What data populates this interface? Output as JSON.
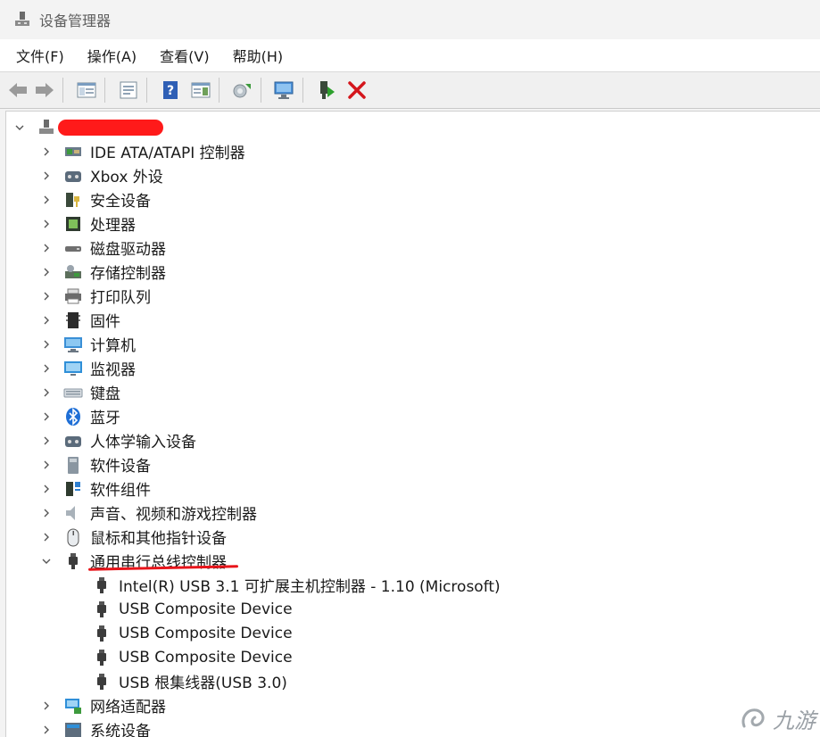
{
  "window": {
    "title": "设备管理器"
  },
  "menu": [
    "文件(F)",
    "操作(A)",
    "查看(V)",
    "帮助(H)"
  ],
  "toolbar": {
    "buttons": [
      "back-arrow",
      "forward-arrow",
      "show-hide-console-tree",
      "properties",
      "help",
      "action-pane",
      "update-driver",
      "scan-hardware-changes",
      "enable-device",
      "uninstall-device"
    ]
  },
  "tree": {
    "categories": [
      {
        "label": "IDE ATA/ATAPI 控制器",
        "icon": "ide-controller-icon"
      },
      {
        "label": "Xbox 外设",
        "icon": "xbox-peripheral-icon"
      },
      {
        "label": "安全设备",
        "icon": "security-device-icon"
      },
      {
        "label": "处理器",
        "icon": "processor-icon"
      },
      {
        "label": "磁盘驱动器",
        "icon": "disk-drive-icon"
      },
      {
        "label": "存储控制器",
        "icon": "storage-controller-icon"
      },
      {
        "label": "打印队列",
        "icon": "printer-icon"
      },
      {
        "label": "固件",
        "icon": "firmware-icon"
      },
      {
        "label": "计算机",
        "icon": "computer-icon"
      },
      {
        "label": "监视器",
        "icon": "monitor-icon"
      },
      {
        "label": "键盘",
        "icon": "keyboard-icon"
      },
      {
        "label": "蓝牙",
        "icon": "bluetooth-icon"
      },
      {
        "label": "人体学输入设备",
        "icon": "hid-icon"
      },
      {
        "label": "软件设备",
        "icon": "software-device-icon"
      },
      {
        "label": "软件组件",
        "icon": "software-component-icon"
      },
      {
        "label": "声音、视频和游戏控制器",
        "icon": "sound-icon"
      },
      {
        "label": "鼠标和其他指针设备",
        "icon": "mouse-icon"
      },
      {
        "label": "通用串行总线控制器",
        "icon": "usb-icon"
      }
    ],
    "usb_children": [
      "Intel(R) USB 3.1 可扩展主机控制器 - 1.10 (Microsoft)",
      "USB Composite Device",
      "USB Composite Device",
      "USB Composite Device",
      "USB 根集线器(USB 3.0)"
    ],
    "after": [
      {
        "label": "网络适配器",
        "icon": "network-adapter-icon"
      },
      {
        "label": "系统设备",
        "icon": "system-device-icon"
      }
    ]
  },
  "colors": {
    "uninstall": "#d4161c",
    "annotation": "#e8141a"
  },
  "watermark": {
    "text": "九游"
  }
}
